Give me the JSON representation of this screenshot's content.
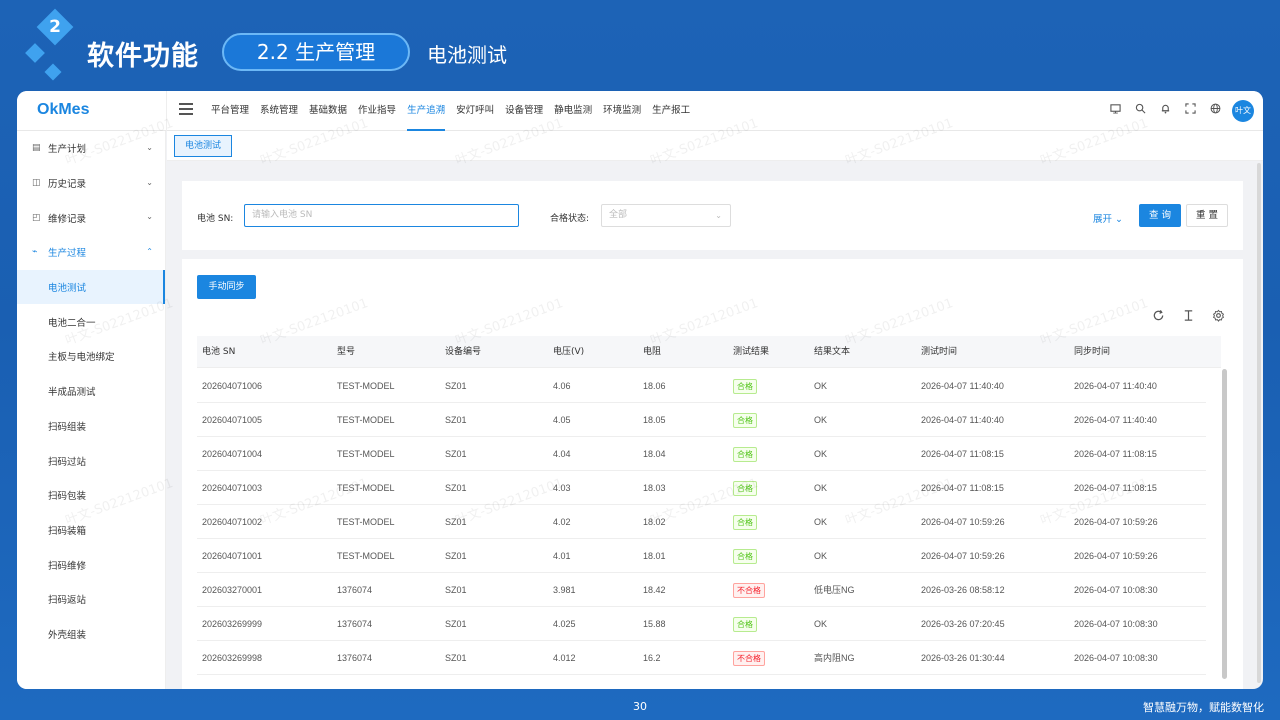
{
  "slide": {
    "section_number": "2",
    "title": "软件功能",
    "section_pill": "2.2 生产管理",
    "subtitle": "电池测试",
    "page_number": "30",
    "slogan": "智慧融万物，赋能数智化"
  },
  "app": {
    "logo": "OkMes",
    "nav": [
      "平台管理",
      "系统管理",
      "基础数据",
      "作业指导",
      "生产追溯",
      "安灯呼叫",
      "设备管理",
      "静电监测",
      "环境监测",
      "生产报工"
    ],
    "nav_active_index": 4,
    "top_icons": [
      "monitor-icon",
      "search-icon",
      "bell-icon",
      "fullscreen-icon",
      "globe-icon"
    ],
    "avatar": "叶文",
    "watermark": "叶文-S022120101"
  },
  "sidebar": {
    "groups": [
      {
        "label": "生产计划",
        "icon": "plan-icon",
        "expanded": false
      },
      {
        "label": "历史记录",
        "icon": "history-icon",
        "expanded": false
      },
      {
        "label": "维修记录",
        "icon": "repair-icon",
        "expanded": false
      },
      {
        "label": "生产过程",
        "icon": "process-icon",
        "expanded": true
      }
    ],
    "sub_items": [
      "电池测试",
      "电池二合一",
      "主板与电池绑定",
      "半成品测试",
      "扫码组装",
      "扫码过站",
      "扫码包装",
      "扫码装箱",
      "扫码维修",
      "扫码返站",
      "外壳组装"
    ],
    "active_sub_index": 0
  },
  "tabs": {
    "active": "电池测试"
  },
  "search": {
    "sn_label": "电池 SN:",
    "sn_placeholder": "请输入电池 SN",
    "status_label": "合格状态:",
    "status_value": "全部",
    "expand_label": "展开",
    "query_label": "查 询",
    "reset_label": "重 置"
  },
  "toolbar": {
    "sync_label": "手动同步",
    "tools": [
      "refresh-icon",
      "column-height-icon",
      "settings-icon"
    ]
  },
  "table": {
    "columns": [
      "电池 SN",
      "型号",
      "设备编号",
      "电压(V)",
      "电阻",
      "测试结果",
      "结果文本",
      "测试时间",
      "同步时间"
    ],
    "rows": [
      {
        "sn": "202604071006",
        "model": "TEST-MODEL",
        "device": "SZ01",
        "voltage": "4.06",
        "resistance": "18.06",
        "result": "合格",
        "pass": true,
        "text": "OK",
        "test_time": "2026-04-07 11:40:40",
        "sync_time": "2026-04-07 11:40:40"
      },
      {
        "sn": "202604071005",
        "model": "TEST-MODEL",
        "device": "SZ01",
        "voltage": "4.05",
        "resistance": "18.05",
        "result": "合格",
        "pass": true,
        "text": "OK",
        "test_time": "2026-04-07 11:40:40",
        "sync_time": "2026-04-07 11:40:40"
      },
      {
        "sn": "202604071004",
        "model": "TEST-MODEL",
        "device": "SZ01",
        "voltage": "4.04",
        "resistance": "18.04",
        "result": "合格",
        "pass": true,
        "text": "OK",
        "test_time": "2026-04-07 11:08:15",
        "sync_time": "2026-04-07 11:08:15"
      },
      {
        "sn": "202604071003",
        "model": "TEST-MODEL",
        "device": "SZ01",
        "voltage": "4.03",
        "resistance": "18.03",
        "result": "合格",
        "pass": true,
        "text": "OK",
        "test_time": "2026-04-07 11:08:15",
        "sync_time": "2026-04-07 11:08:15"
      },
      {
        "sn": "202604071002",
        "model": "TEST-MODEL",
        "device": "SZ01",
        "voltage": "4.02",
        "resistance": "18.02",
        "result": "合格",
        "pass": true,
        "text": "OK",
        "test_time": "2026-04-07 10:59:26",
        "sync_time": "2026-04-07 10:59:26"
      },
      {
        "sn": "202604071001",
        "model": "TEST-MODEL",
        "device": "SZ01",
        "voltage": "4.01",
        "resistance": "18.01",
        "result": "合格",
        "pass": true,
        "text": "OK",
        "test_time": "2026-04-07 10:59:26",
        "sync_time": "2026-04-07 10:59:26"
      },
      {
        "sn": "202603270001",
        "model": "1376074",
        "device": "SZ01",
        "voltage": "3.981",
        "resistance": "18.42",
        "result": "不合格",
        "pass": false,
        "text": "低电压NG",
        "test_time": "2026-03-26 08:58:12",
        "sync_time": "2026-04-07 10:08:30"
      },
      {
        "sn": "202603269999",
        "model": "1376074",
        "device": "SZ01",
        "voltage": "4.025",
        "resistance": "15.88",
        "result": "合格",
        "pass": true,
        "text": "OK",
        "test_time": "2026-03-26 07:20:45",
        "sync_time": "2026-04-07 10:08:30"
      },
      {
        "sn": "202603269998",
        "model": "1376074",
        "device": "SZ01",
        "voltage": "4.012",
        "resistance": "16.2",
        "result": "不合格",
        "pass": false,
        "text": "高内阻NG",
        "test_time": "2026-03-26 01:30:44",
        "sync_time": "2026-04-07 10:08:30"
      }
    ]
  },
  "colors": {
    "primary": "#1b86e0",
    "slide_bg": "#1d63b6",
    "pass": "#52c41a",
    "fail": "#f5222d"
  }
}
